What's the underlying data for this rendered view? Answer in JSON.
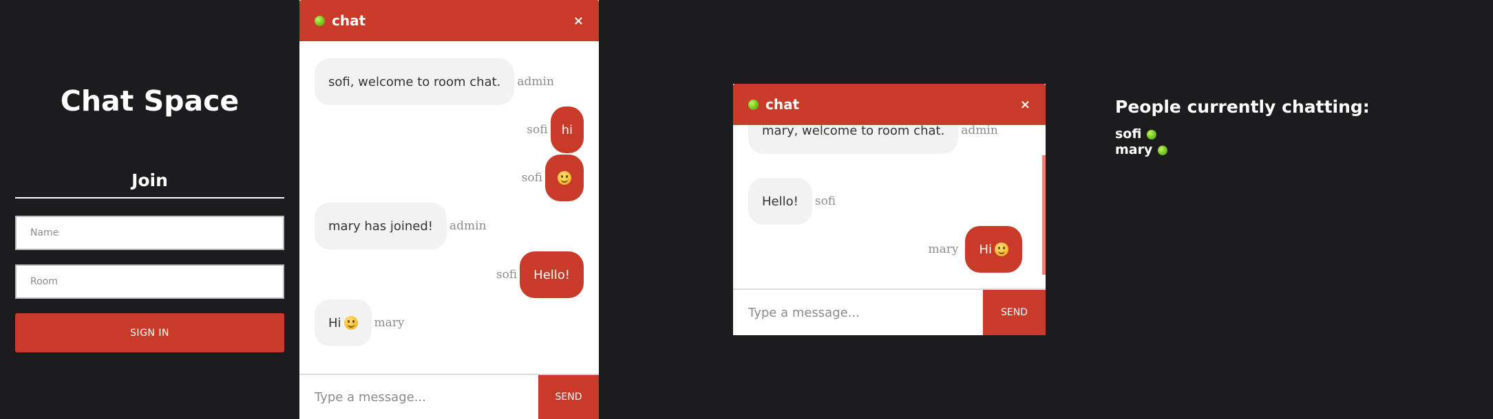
{
  "join": {
    "app_title": "Chat Space",
    "heading": "Join",
    "name_placeholder": "Name",
    "room_placeholder": "Room",
    "signin_label": "SIGN IN"
  },
  "chat_left": {
    "room_name": "chat",
    "close_glyph": "×",
    "messages": [
      {
        "text": "sofi, welcome to room chat.",
        "sender": "admin"
      },
      {
        "sender": "sofi",
        "text": "hi"
      },
      {
        "sender": "sofi",
        "emoji": "smiley"
      },
      {
        "text": "mary has joined!",
        "sender": "admin"
      },
      {
        "sender": "sofi",
        "text": "Hello!"
      },
      {
        "text": "Hi",
        "emoji": "smiley",
        "sender": "mary"
      }
    ],
    "input_placeholder": "Type a message...",
    "send_label": "SEND"
  },
  "chat_right": {
    "room_name": "chat",
    "close_glyph": "×",
    "messages": [
      {
        "text": "mary, welcome to room chat.",
        "sender": "admin"
      },
      {
        "text": "Hello!",
        "sender": "sofi"
      },
      {
        "sender": "mary",
        "text": "Hi",
        "emoji": "smiley"
      }
    ],
    "input_placeholder": "Type a message...",
    "send_label": "SEND"
  },
  "people": {
    "title": "People currently chatting:",
    "users": [
      {
        "name": "sofi",
        "status": "online"
      },
      {
        "name": "mary",
        "status": "online"
      }
    ]
  },
  "colors": {
    "background": "#1c1c1e",
    "accent": "#c83b28",
    "bubble": "#f2f2f2",
    "online": "#7fcf25"
  },
  "icons": {
    "online": "online-dot-icon",
    "close": "close-icon",
    "emoji": "smiley-emoji-icon"
  }
}
